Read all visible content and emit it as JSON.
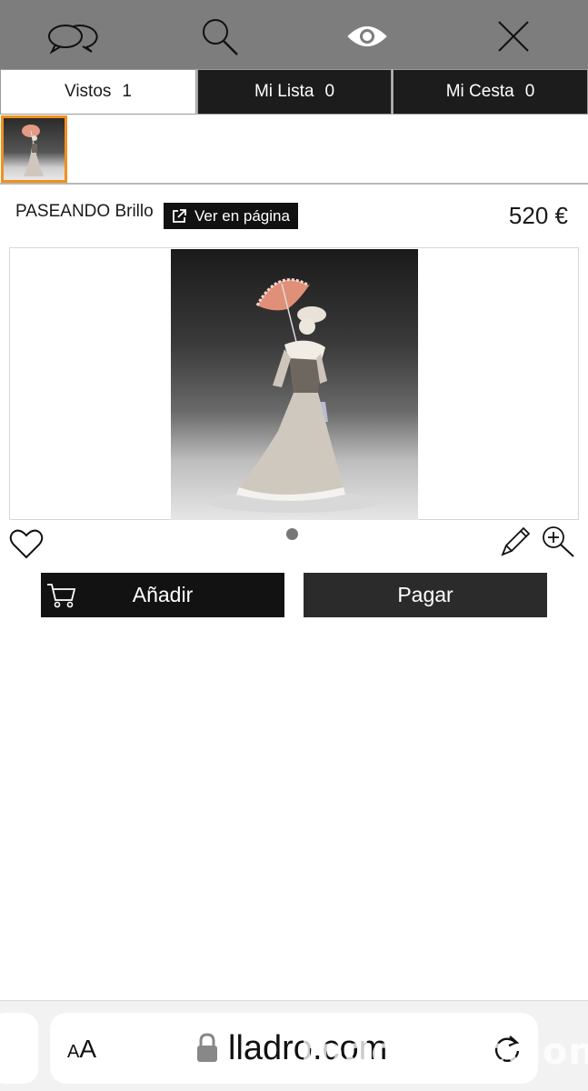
{
  "topbar": {
    "icons": [
      "chat-bubbles-icon",
      "search-icon",
      "eye-icon",
      "close-icon"
    ]
  },
  "tabs": [
    {
      "label": "Vistos",
      "count": "1"
    },
    {
      "label": "Mi Lista",
      "count": "0"
    },
    {
      "label": "Mi Cesta",
      "count": "0"
    }
  ],
  "product": {
    "name": "PASEANDO Brillo",
    "view_label": "Ver en página",
    "price": "520 €"
  },
  "actions": {
    "add_label": "Añadir",
    "pay_label": "Pagar"
  },
  "browser": {
    "aa_small": "A",
    "aa_large": "A",
    "url": "lladro.com"
  },
  "watermark": "todocoleccion",
  "colors": {
    "topbar": "#7d7d7d",
    "accent_border": "#f0901e",
    "dark_button": "#1a1a1a"
  }
}
